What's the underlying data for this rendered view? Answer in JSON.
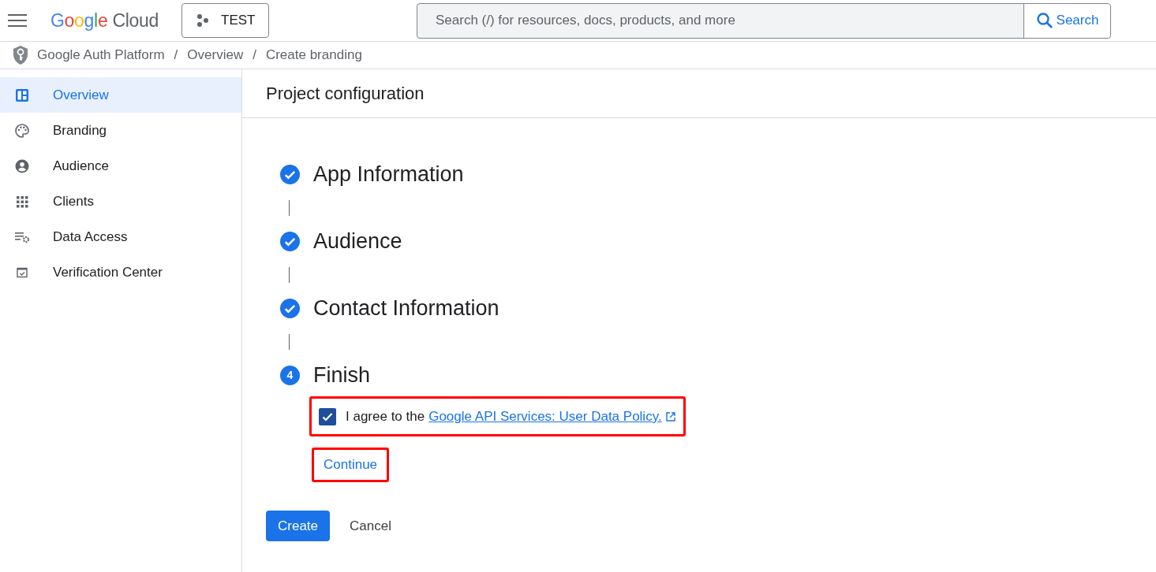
{
  "header": {
    "logo": {
      "brand": "Google",
      "product": "Cloud"
    },
    "project": "TEST",
    "search": {
      "placeholder": "Search (/) for resources, docs, products, and more",
      "button": "Search"
    }
  },
  "breadcrumb": [
    {
      "kind": "link",
      "text": "Google Auth Platform"
    },
    {
      "kind": "separator",
      "text": "/"
    },
    {
      "kind": "link",
      "text": "Overview"
    },
    {
      "kind": "separator",
      "text": "/"
    },
    {
      "kind": "link",
      "text": "Create branding"
    }
  ],
  "sidebar": {
    "items": [
      {
        "label": "Overview",
        "selected": true
      },
      {
        "label": "Branding",
        "selected": false
      },
      {
        "label": "Audience",
        "selected": false
      },
      {
        "label": "Clients",
        "selected": false
      },
      {
        "label": "Data Access",
        "selected": false
      },
      {
        "label": "Verification Center",
        "selected": false
      }
    ]
  },
  "page": {
    "title": "Project configuration",
    "steps": [
      {
        "title": "App Information",
        "completed": true
      },
      {
        "title": "Audience",
        "completed": true
      },
      {
        "title": "Contact Information",
        "completed": true
      },
      {
        "title": "Finish",
        "completed": false,
        "number": "4"
      }
    ],
    "agreement": {
      "checked": true,
      "text": "I agree to the",
      "link": "Google API Services: User Data Policy.",
      "highlighted": true
    },
    "continue": {
      "label": "Continue",
      "highlighted": true
    },
    "actions": {
      "primary": "Create",
      "secondary": "Cancel"
    }
  }
}
